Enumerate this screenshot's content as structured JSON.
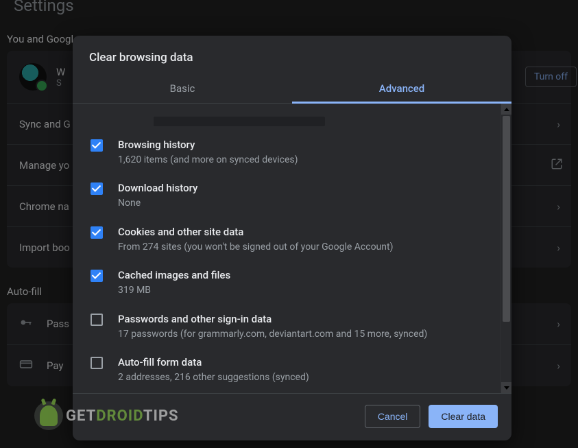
{
  "background": {
    "settings_title": "Settings",
    "section1_title": "You and Google",
    "profile": {
      "name_initial": "W",
      "sub_initial": "S"
    },
    "turn_off": "Turn off",
    "rows": {
      "sync": "Sync and G",
      "manage": "Manage yo",
      "chrome_name": "Chrome na",
      "import": "Import boo"
    },
    "section2_title": "Auto-fill",
    "autofill_rows": {
      "passwords": "Pass",
      "payments": "Pay"
    }
  },
  "dialog": {
    "title": "Clear browsing data",
    "tabs": {
      "basic": "Basic",
      "advanced": "Advanced"
    },
    "items": [
      {
        "checked": true,
        "label": "Browsing history",
        "desc": "1,620 items (and more on synced devices)"
      },
      {
        "checked": true,
        "label": "Download history",
        "desc": "None"
      },
      {
        "checked": true,
        "label": "Cookies and other site data",
        "desc": "From 274 sites (you won't be signed out of your Google Account)"
      },
      {
        "checked": true,
        "label": "Cached images and files",
        "desc": "319 MB"
      },
      {
        "checked": false,
        "label": "Passwords and other sign-in data",
        "desc": "17 passwords (for grammarly.com, deviantart.com and 15 more, synced)"
      },
      {
        "checked": false,
        "label": "Auto-fill form data",
        "desc": "2 addresses, 216 other suggestions (synced)"
      }
    ],
    "footer": {
      "cancel": "Cancel",
      "clear": "Clear data"
    }
  },
  "watermark": {
    "part1": "GET",
    "part2": "DROID",
    "part3": "TIPS"
  }
}
